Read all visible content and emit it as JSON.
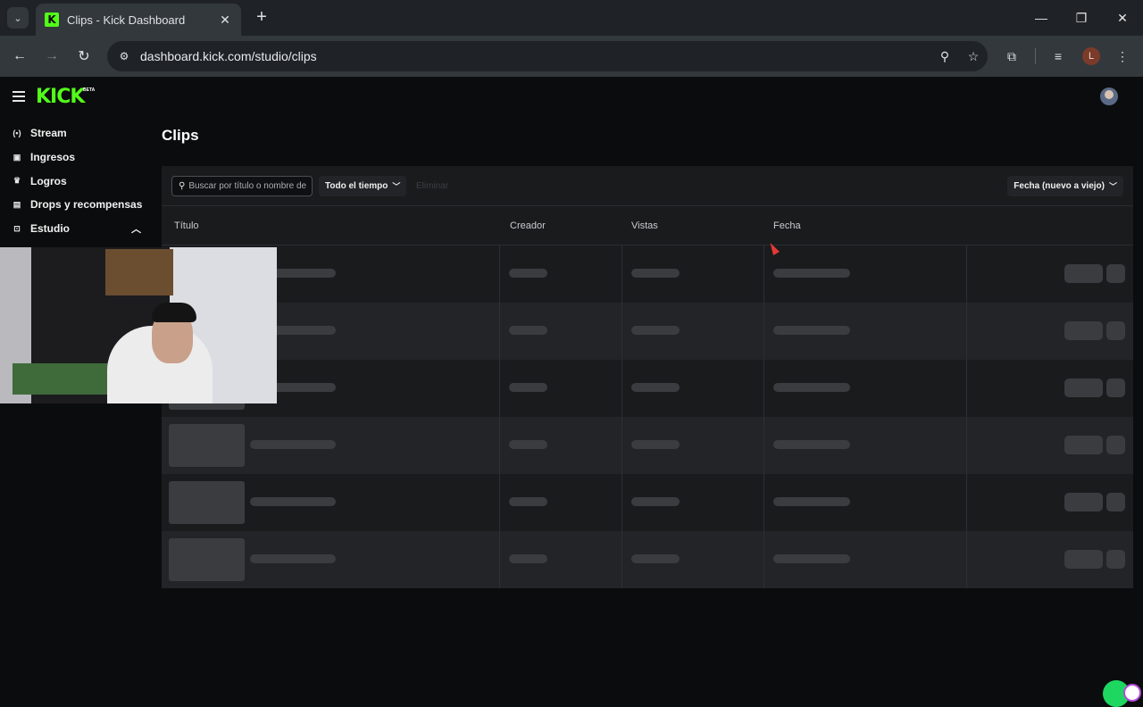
{
  "browser": {
    "tab_title": "Clips - Kick Dashboard",
    "url": "dashboard.kick.com/studio/clips",
    "profile_initial": "L",
    "icons": [
      "tab-list-icon",
      "close-icon",
      "new-tab-icon",
      "minimize-icon",
      "restore-icon",
      "window-close-icon",
      "back-icon",
      "forward-icon",
      "reload-icon",
      "site-info-icon",
      "zoom-icon",
      "bookmark-star-icon",
      "extensions-icon",
      "media-control-icon",
      "menu-dots-icon"
    ]
  },
  "app": {
    "logo": "KICK",
    "logo_badge": "BETA",
    "accent_color": "#53fc18",
    "sidebar": {
      "items": [
        {
          "label": "Stream",
          "icon": "broadcast-icon"
        },
        {
          "label": "Ingresos",
          "icon": "revenue-icon"
        },
        {
          "label": "Logros",
          "icon": "trophy-icon"
        },
        {
          "label": "Drops y recompensas",
          "icon": "gift-icon"
        },
        {
          "label": "Estudio",
          "icon": "studio-icon",
          "expanded": true
        }
      ]
    },
    "page_title": "Clips",
    "filters": {
      "search_placeholder": "Buscar por título o nombre de",
      "time_filter": "Todo el tiempo",
      "disabled_action": "Eliminar",
      "sort": "Fecha (nuevo a viejo)"
    },
    "table": {
      "columns": [
        "Título",
        "Creador",
        "Vistas",
        "Fecha"
      ],
      "loading_rows": 6
    }
  }
}
